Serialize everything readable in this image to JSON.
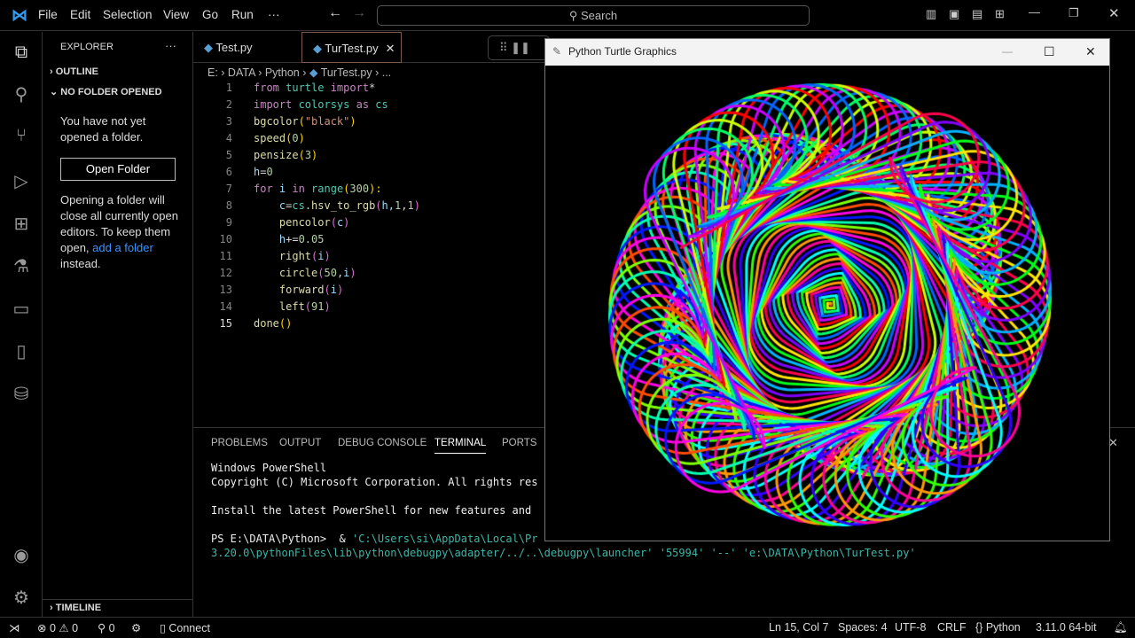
{
  "titlebar": {
    "menus": [
      "File",
      "Edit",
      "Selection",
      "View",
      "Go",
      "Run",
      "···"
    ],
    "search": "Search"
  },
  "sidebar": {
    "title": "EXPLORER",
    "more": "···",
    "outline": "OUTLINE",
    "no_folder": "NO FOLDER OPENED",
    "msg": "You have not yet opened a folder.",
    "open_button": "Open Folder",
    "info_1": "Opening a folder will close all currently open editors. To keep them open, ",
    "info_link": "add a folder",
    "info_2": " instead.",
    "timeline": "TIMELINE"
  },
  "tabs": [
    {
      "label": "Test.py"
    },
    {
      "label": "TurTest.py",
      "active": true
    }
  ],
  "breadcrumb": [
    "E:",
    "DATA",
    "Python",
    "TurTest.py",
    "..."
  ],
  "code": [
    [
      [
        "from",
        "#c586c0"
      ],
      [
        " turtle ",
        "#4ec9b0"
      ],
      [
        "import",
        "#c586c0"
      ],
      [
        "*",
        "#d4d4d4"
      ]
    ],
    [
      [
        "import",
        "#c586c0"
      ],
      [
        " colorsys ",
        "#4ec9b0"
      ],
      [
        "as",
        "#c586c0"
      ],
      [
        " cs",
        "#4ec9b0"
      ]
    ],
    [
      [
        "bgcolor",
        "#dcdcaa"
      ],
      [
        "(",
        "#ffd700"
      ],
      [
        "\"black\"",
        "#ce9178"
      ],
      [
        ")",
        "#ffd700"
      ]
    ],
    [
      [
        "speed",
        "#dcdcaa"
      ],
      [
        "(",
        "#ffd700"
      ],
      [
        "0",
        "#b5cea8"
      ],
      [
        ")",
        "#ffd700"
      ]
    ],
    [
      [
        "pensize",
        "#dcdcaa"
      ],
      [
        "(",
        "#ffd700"
      ],
      [
        "3",
        "#b5cea8"
      ],
      [
        ")",
        "#ffd700"
      ]
    ],
    [
      [
        "h",
        "#9cdcfe"
      ],
      [
        "=",
        "#d4d4d4"
      ],
      [
        "0",
        "#b5cea8"
      ]
    ],
    [
      [
        "for",
        "#c586c0"
      ],
      [
        " i ",
        "#9cdcfe"
      ],
      [
        "in",
        "#c586c0"
      ],
      [
        " range",
        "#4ec9b0"
      ],
      [
        "(",
        "#ffd700"
      ],
      [
        "300",
        "#b5cea8"
      ],
      [
        "):",
        "#ffd700"
      ]
    ],
    [
      [
        "    c",
        "#9cdcfe"
      ],
      [
        "=",
        "#d4d4d4"
      ],
      [
        "cs",
        "#4ec9b0"
      ],
      [
        ".",
        "#d4d4d4"
      ],
      [
        "hsv_to_rgb",
        "#dcdcaa"
      ],
      [
        "(",
        "#da70d6"
      ],
      [
        "h,",
        "#9cdcfe"
      ],
      [
        "1",
        "#b5cea8"
      ],
      [
        ",",
        "#d4d4d4"
      ],
      [
        "1",
        "#b5cea8"
      ],
      [
        ")",
        "#da70d6"
      ]
    ],
    [
      [
        "    pencolor",
        "#dcdcaa"
      ],
      [
        "(",
        "#da70d6"
      ],
      [
        "c",
        "#9cdcfe"
      ],
      [
        ")",
        "#da70d6"
      ]
    ],
    [
      [
        "    h",
        "#9cdcfe"
      ],
      [
        "+=",
        "#d4d4d4"
      ],
      [
        "0.05",
        "#b5cea8"
      ]
    ],
    [
      [
        "    right",
        "#dcdcaa"
      ],
      [
        "(",
        "#da70d6"
      ],
      [
        "i",
        "#9cdcfe"
      ],
      [
        ")",
        "#da70d6"
      ]
    ],
    [
      [
        "    circle",
        "#dcdcaa"
      ],
      [
        "(",
        "#da70d6"
      ],
      [
        "50",
        "#b5cea8"
      ],
      [
        ",",
        "#d4d4d4"
      ],
      [
        "i",
        "#9cdcfe"
      ],
      [
        ")",
        "#da70d6"
      ]
    ],
    [
      [
        "    forward",
        "#dcdcaa"
      ],
      [
        "(",
        "#da70d6"
      ],
      [
        "i",
        "#9cdcfe"
      ],
      [
        ")",
        "#da70d6"
      ]
    ],
    [
      [
        "    left",
        "#dcdcaa"
      ],
      [
        "(",
        "#da70d6"
      ],
      [
        "91",
        "#b5cea8"
      ],
      [
        ")",
        "#da70d6"
      ]
    ],
    [
      [
        "done",
        "#dcdcaa"
      ],
      [
        "()",
        "#ffd700"
      ]
    ]
  ],
  "panel": {
    "tabs": [
      "PROBLEMS",
      "OUTPUT",
      "DEBUG CONSOLE",
      "TERMINAL",
      "PORTS"
    ],
    "lines": [
      "Windows PowerShell",
      "Copyright (C) Microsoft Corporation. All rights res",
      "",
      "Install the latest PowerShell for new features and "
    ],
    "prompt": "PS E:\\DATA\\Python>  & ",
    "cmd1": "'C:\\Users\\si\\AppData\\Local\\Pr",
    "cmd2": "3.20.0\\pythonFiles\\lib\\python\\debugpy\\adapter/../..\\debugpy\\launcher' '55994' '--' 'e:\\DATA\\Python\\TurTest.py'"
  },
  "status": {
    "errors": "0",
    "warnings": "0",
    "ports": "0",
    "connect": "Connect",
    "pos": "Ln 15, Col 7",
    "spaces": "Spaces: 4",
    "enc": "UTF-8",
    "eol": "CRLF",
    "lang": "Python",
    "interp": "3.11.0 64-bit"
  },
  "turtle_window": {
    "title": "Python Turtle Graphics",
    "pensize": 3,
    "steps": 300,
    "hue_step": 0.05,
    "radius": 50,
    "left_angle": 91
  }
}
